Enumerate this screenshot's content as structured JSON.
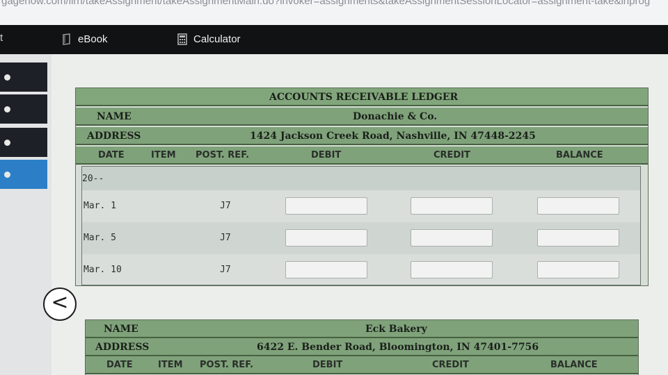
{
  "browser": {
    "url_fragment": "gagenow.com/ilrn/takeAssignment/takeAssignmentMain.do?invoker=assignments&takeAssignmentSessionLocator=assignment-take&inprog"
  },
  "toolbar": {
    "cut_label": "t",
    "ebook_label": "eBook",
    "calculator_label": "Calculator"
  },
  "nav": {
    "back_icon": "chevron-left-icon",
    "back_glyph": "<"
  },
  "ledger1": {
    "title": "ACCOUNTS RECEIVABLE LEDGER",
    "name_label": "NAME",
    "name_value": "Donachie & Co.",
    "address_label": "ADDRESS",
    "address_value": "1424 Jackson Creek Road, Nashville, IN 47448-2245",
    "columns": [
      "DATE",
      "ITEM",
      "POST. REF.",
      "DEBIT",
      "CREDIT",
      "BALANCE"
    ],
    "year": "20--",
    "rows": [
      {
        "date": "Mar. 1",
        "post_ref": "J7",
        "debit": "",
        "credit": "",
        "balance": ""
      },
      {
        "date": "Mar. 5",
        "post_ref": "J7",
        "debit": "",
        "credit": "",
        "balance": ""
      },
      {
        "date": "Mar. 10",
        "post_ref": "J7",
        "debit": "",
        "credit": "",
        "balance": ""
      }
    ]
  },
  "ledger2": {
    "name_label": "NAME",
    "name_value": "Eck Bakery",
    "address_label": "ADDRESS",
    "address_value": "6422 E. Bender Road, Bloomington, IN 47401-7756",
    "columns": [
      "DATE",
      "ITEM",
      "POST. REF.",
      "DEBIT",
      "CREDIT",
      "BALANCE"
    ]
  },
  "colors": {
    "ledger_green": "#82a67b",
    "active_nav": "#2c7fc7",
    "topbar": "#111214"
  }
}
